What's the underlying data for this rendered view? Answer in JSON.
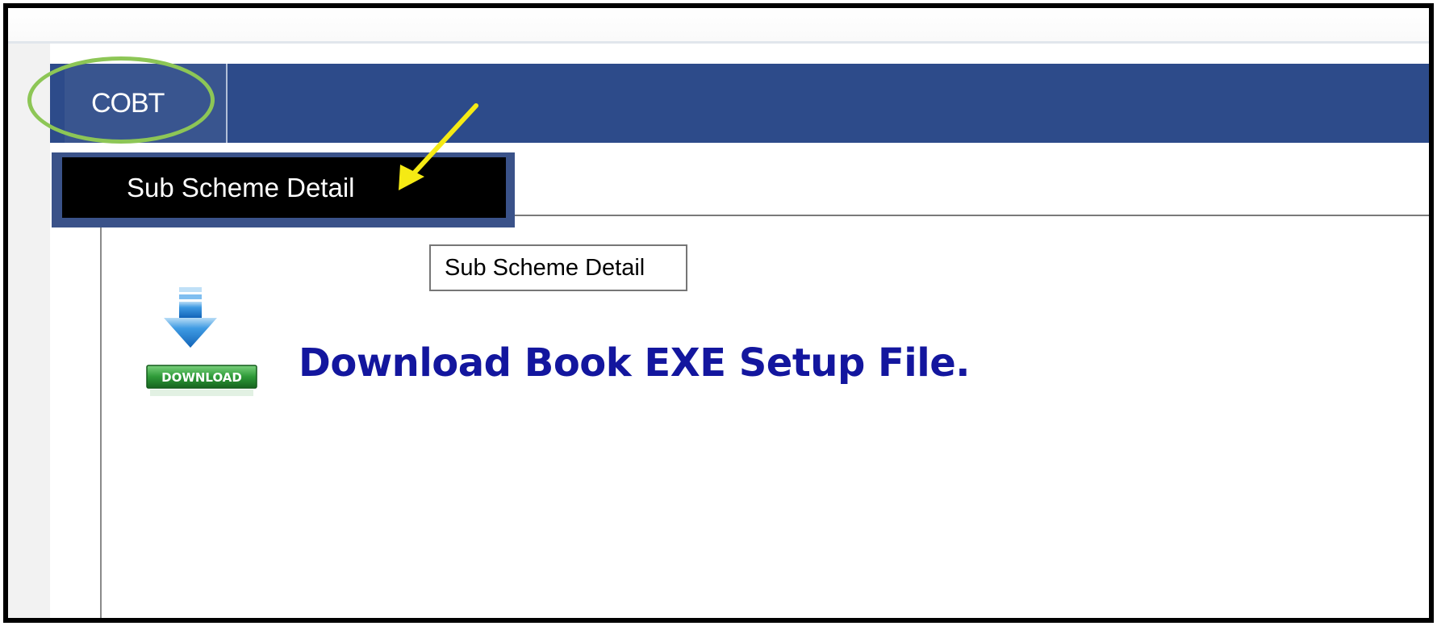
{
  "menu": {
    "top_item": "COBT",
    "dropdown_item": "Sub Scheme Detail"
  },
  "tooltip": {
    "text": "Sub Scheme Detail"
  },
  "content": {
    "download_icon_text": "DOWNLOAD",
    "download_link_text": "Download Book EXE Setup File."
  },
  "annotations": {
    "highlight_color": "#8dc656",
    "arrow_color": "#f5ea14"
  },
  "colors": {
    "navbar": "#2d4b8a",
    "link": "#13169e",
    "frame_border": "#000000"
  }
}
